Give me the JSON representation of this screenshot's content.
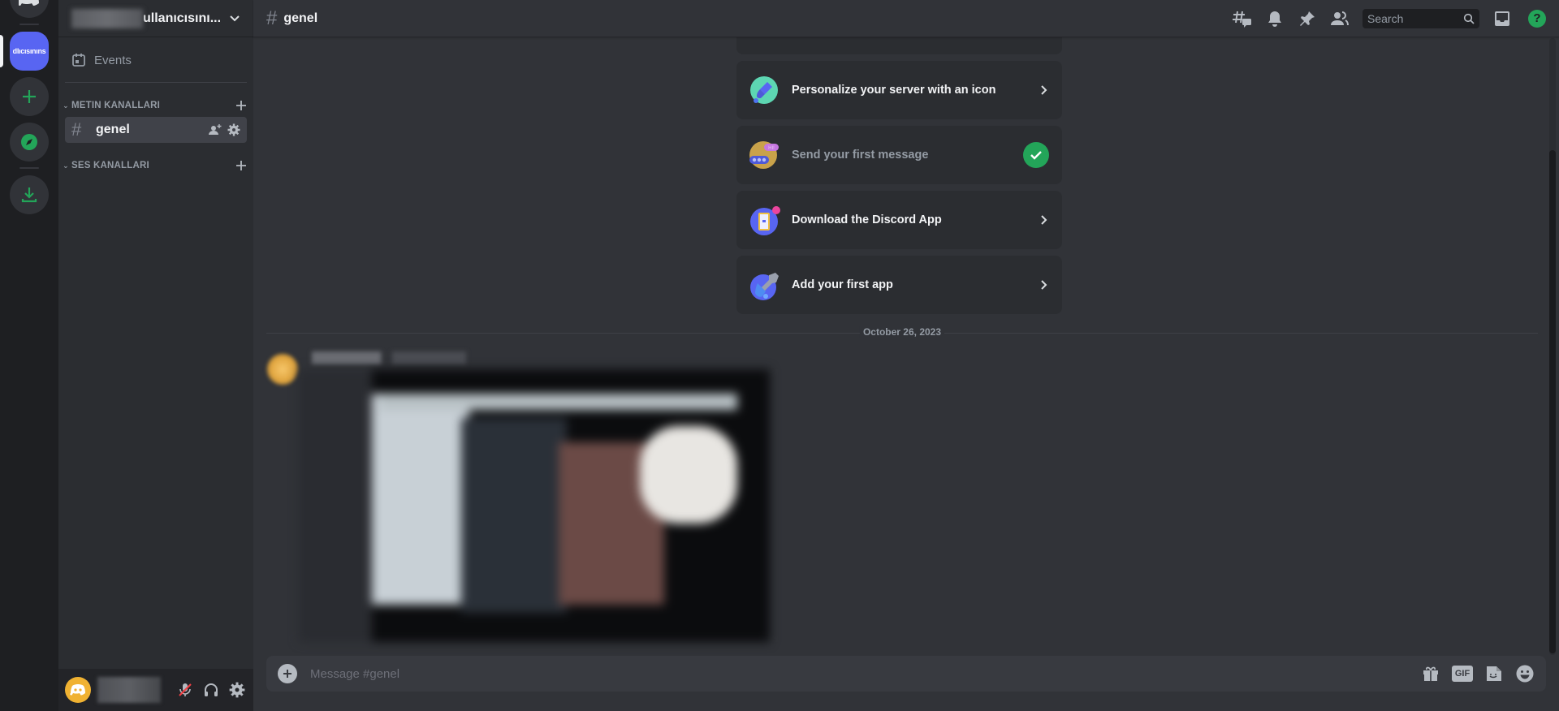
{
  "rail": {
    "active_server_label": "dlıcısınıns"
  },
  "sidebar": {
    "guild_name": "ullanıcısını...",
    "events_label": "Events",
    "categories": [
      {
        "label": "METIN KANALLARI",
        "channels": [
          {
            "name": "genel",
            "selected": true
          }
        ]
      },
      {
        "label": "SES KANALLARI",
        "channels": []
      }
    ]
  },
  "header": {
    "channel_name": "genel",
    "search_placeholder": "Search",
    "help_label": "?"
  },
  "checklist": {
    "items": [
      {
        "label": "Personalize your server with an icon",
        "done": false,
        "icon": "paintbrush-icon",
        "color": "#5dd6b2"
      },
      {
        "label": "Send your first message",
        "done": true,
        "icon": "chat-bubble-icon",
        "color": "#c9a24a"
      },
      {
        "label": "Download the Discord App",
        "done": false,
        "icon": "phone-icon",
        "color": "#5865f2"
      },
      {
        "label": "Add your first app",
        "done": false,
        "icon": "wrench-icon",
        "color": "#5865f2"
      }
    ]
  },
  "messages": {
    "date_divider": "October 26, 2023"
  },
  "composer": {
    "placeholder": "Message #genel",
    "gif_label": "GIF"
  },
  "colors": {
    "accent": "#5865f2",
    "success": "#23a559",
    "avatar": "#f0b232"
  }
}
